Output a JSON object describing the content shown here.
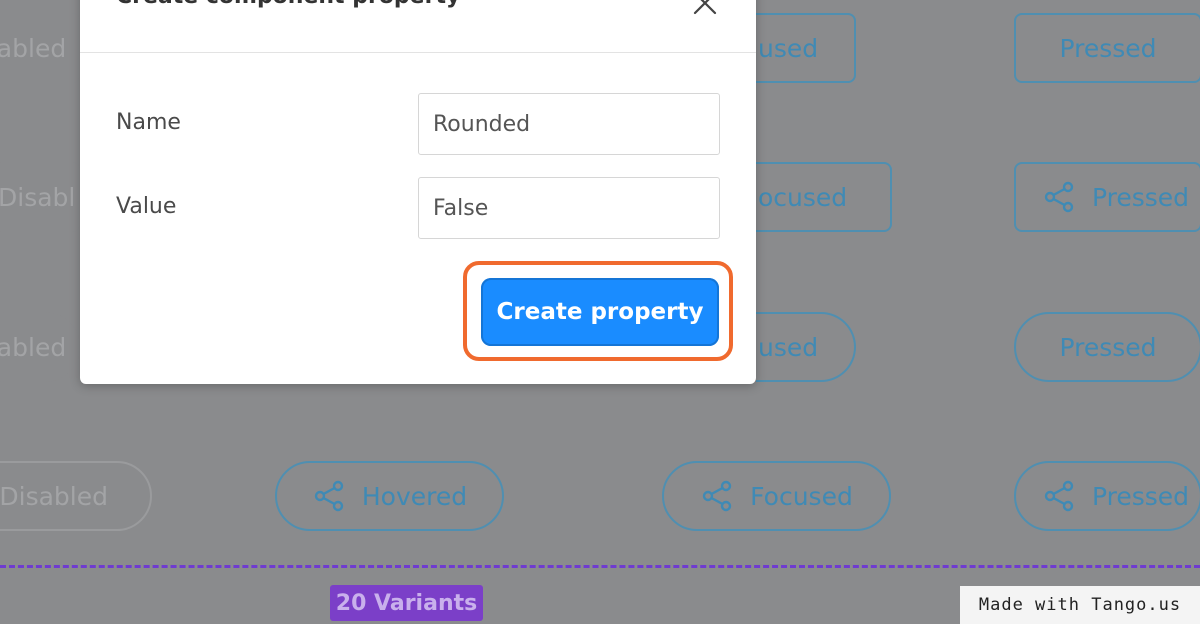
{
  "dialog": {
    "title": "Create component property",
    "fields": [
      {
        "label": "Name",
        "value": "Rounded"
      },
      {
        "label": "Value",
        "value": "False"
      }
    ],
    "primary_button": "Create property"
  },
  "background": {
    "rows": [
      {
        "disabled": "sabled",
        "focused": "used",
        "pressed": "Pressed"
      },
      {
        "disabled": "Disabl",
        "focused": "ocused",
        "pressed": "Pressed"
      },
      {
        "disabled": "sabled",
        "focused": "used",
        "pressed": "Pressed"
      },
      {
        "disabled": "Disabled",
        "hovered": "Hovered",
        "focused": "Focused",
        "pressed": "Pressed"
      }
    ],
    "variants_badge": "20 Variants",
    "icon": "share-icon"
  },
  "watermark": "Made with Tango.us",
  "colors": {
    "overlay": "#8a8b8d",
    "variant_border": "#4f8fb1",
    "variant_text": "#3f8ab5",
    "primary": "#1a8cff",
    "highlight": "#f06a2e",
    "frame_dash": "#6f3bd0",
    "badge": "#7b3fc8"
  }
}
